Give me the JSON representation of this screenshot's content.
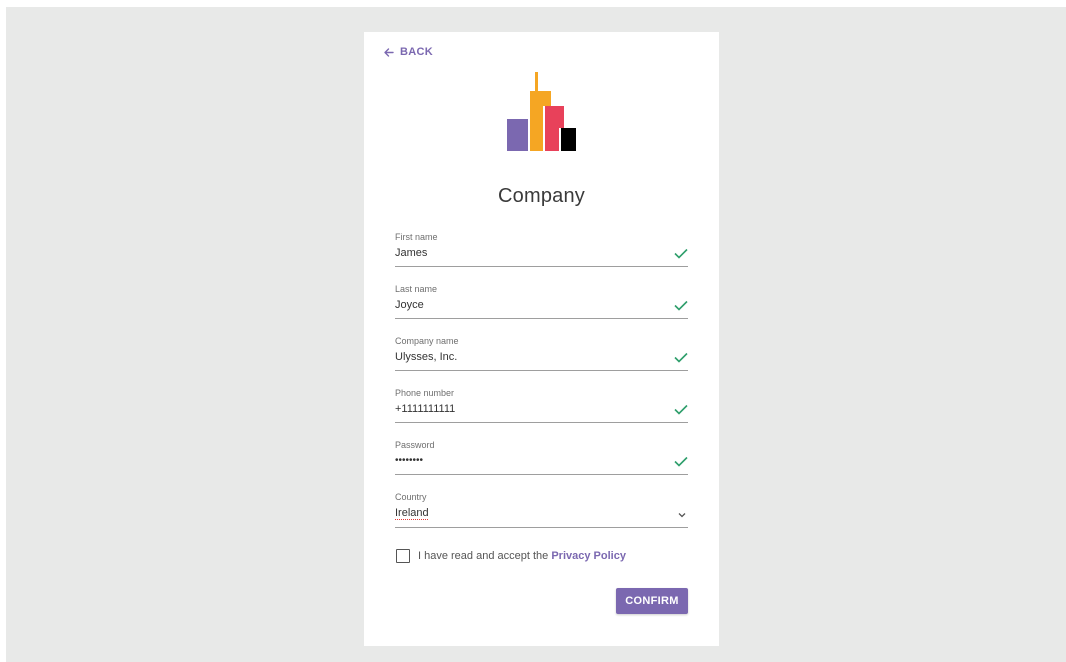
{
  "nav": {
    "back_label": "BACK",
    "back_icon": "arrow-left-icon"
  },
  "brand": {
    "title": "Company",
    "logo_icon": "city-skyline-logo",
    "colors": {
      "purple": "#7b68b0",
      "orange": "#f5a623",
      "red": "#e8415a",
      "black": "#000000"
    }
  },
  "form": {
    "fields": [
      {
        "label": "First name",
        "value": "James",
        "status_icon": "check-icon"
      },
      {
        "label": "Last name",
        "value": "Joyce",
        "status_icon": "check-icon"
      },
      {
        "label": "Company name",
        "value": "Ulysses, Inc.",
        "status_icon": "check-icon"
      },
      {
        "label": "Phone number",
        "value": "+1111111111",
        "status_icon": "check-icon"
      },
      {
        "label": "Password",
        "value": "••••••••",
        "status_icon": "check-icon"
      }
    ],
    "country": {
      "label": "Country",
      "value": "Ireland",
      "icon": "chevron-down-icon"
    },
    "consent": {
      "text": "I have read and accept the ",
      "link": "Privacy Policy",
      "checked": false
    },
    "confirm_label": "CONFIRM"
  },
  "theme": {
    "accent": "#7b68b0",
    "valid": "#2e9e6b",
    "background": "#e8e9e8"
  }
}
